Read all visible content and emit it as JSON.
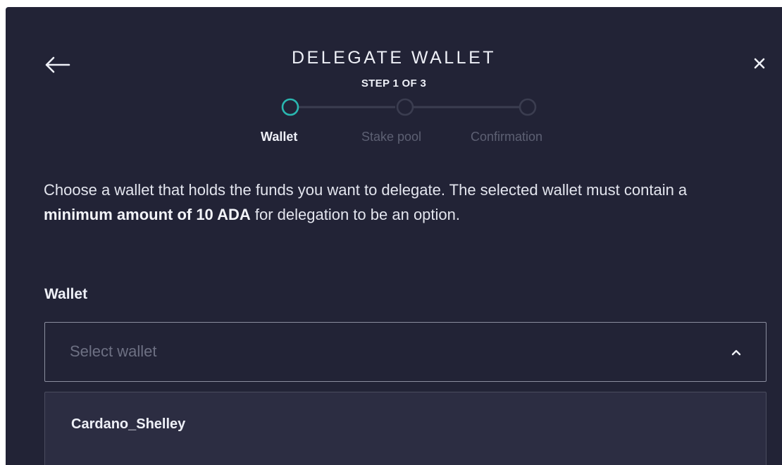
{
  "dialog": {
    "title": "DELEGATE WALLET",
    "step_indicator": "STEP 1 OF 3",
    "back_icon": "arrow-left-icon",
    "close_icon": "close-icon"
  },
  "stepper": {
    "steps": [
      {
        "label": "Wallet",
        "state": "active"
      },
      {
        "label": "Stake pool",
        "state": "inactive"
      },
      {
        "label": "Confirmation",
        "state": "inactive"
      }
    ],
    "active_color": "#2ab7b0",
    "inactive_color": "#3b3d50"
  },
  "content": {
    "description_pre": "Choose a wallet that holds the funds you want to delegate. The selected wallet must contain a ",
    "description_bold": "minimum amount of 10 ADA",
    "description_post": " for delegation to be an option.",
    "wallet_label": "Wallet",
    "select": {
      "placeholder": "Select wallet",
      "chevron_icon": "chevron-up-icon",
      "expanded": true
    },
    "options": [
      {
        "label": "Cardano_Shelley"
      }
    ]
  },
  "colors": {
    "background": "#222336",
    "dropdown_background": "#2c2d42",
    "text": "#eef0f7",
    "muted_text": "#5d6073"
  }
}
